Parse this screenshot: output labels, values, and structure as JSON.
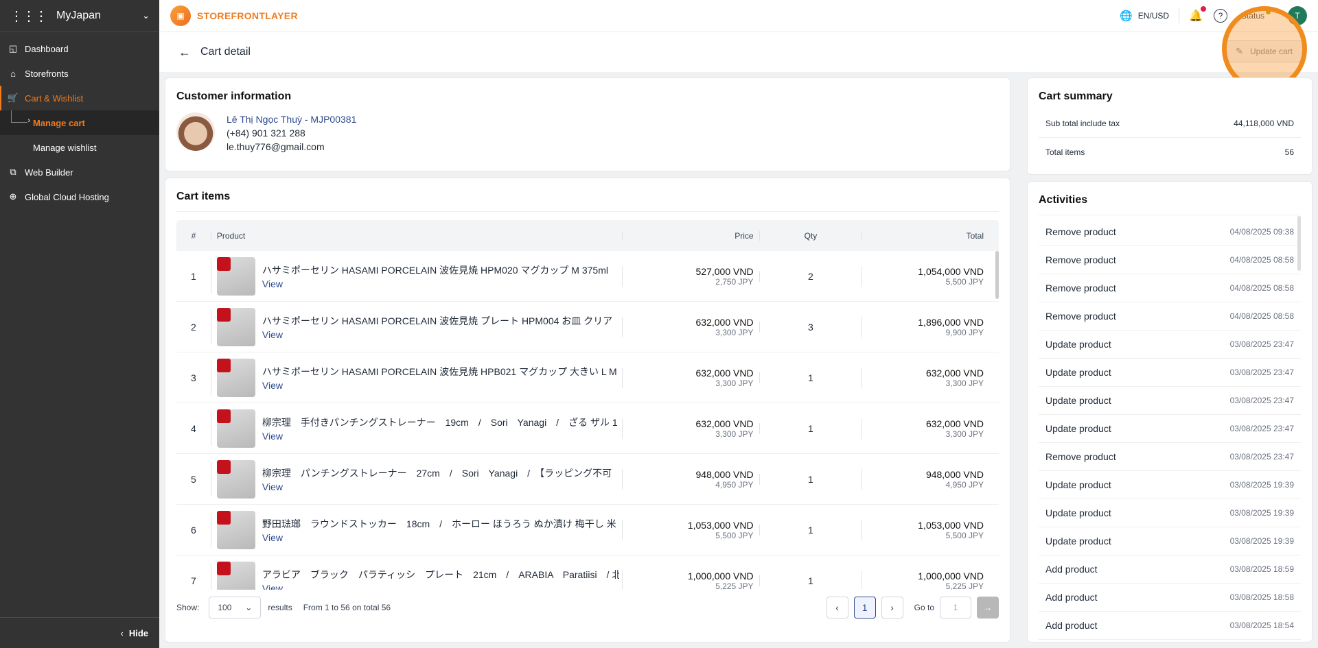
{
  "sidebar": {
    "app_name": "MyJapan",
    "items": [
      {
        "label": "Dashboard",
        "icon": "dashboard-icon"
      },
      {
        "label": "Storefronts",
        "icon": "storefront-icon"
      },
      {
        "label": "Cart & Wishlist",
        "icon": "cart-icon"
      },
      {
        "label": "Web Builder",
        "icon": "web-builder-icon"
      },
      {
        "label": "Global Cloud Hosting",
        "icon": "cloud-hosting-icon"
      }
    ],
    "sub_items": [
      {
        "label": "Manage cart"
      },
      {
        "label": "Manage wishlist"
      }
    ],
    "hide_label": "Hide"
  },
  "topbar": {
    "brand": "STOREFRONTLAYER",
    "locale": "EN/USD",
    "status_label": "Status",
    "avatar_initial": "T"
  },
  "page": {
    "title": "Cart detail",
    "update_button": "Update cart"
  },
  "customer": {
    "heading": "Customer information",
    "name": "Lê Thị Ngọc Thuỳ - MJP00381",
    "phone": "(+84) 901 321 288",
    "email": "le.thuy776@gmail.com"
  },
  "cart_items": {
    "heading": "Cart items",
    "columns": {
      "num": "#",
      "product": "Product",
      "price": "Price",
      "qty": "Qty",
      "total": "Total"
    },
    "view_label": "View",
    "rows": [
      {
        "num": "1",
        "name": "ハサミポーセリン HASAMI PORCELAIN 波佐見焼 HPM020 マグカップ M 375ml",
        "price": "527,000 VND",
        "price_jpy": "2,750 JPY",
        "qty": "2",
        "total": "1,054,000 VND",
        "total_jpy": "5,500 JPY"
      },
      {
        "num": "2",
        "name": "ハサミポーセリン HASAMI PORCELAIN 波佐見焼 プレート HPM004 お皿 クリア",
        "price": "632,000 VND",
        "price_jpy": "3,300 JPY",
        "qty": "3",
        "total": "1,896,000 VND",
        "total_jpy": "9,900 JPY"
      },
      {
        "num": "3",
        "name": "ハサミポーセリン HASAMI PORCELAIN 波佐見焼 HPB021 マグカップ 大きい L M",
        "price": "632,000 VND",
        "price_jpy": "3,300 JPY",
        "qty": "1",
        "total": "632,000 VND",
        "total_jpy": "3,300 JPY"
      },
      {
        "num": "4",
        "name": "柳宗理　手付きパンチングストレーナー　19cm　/　Sori　Yanagi　/　ざる ザル 1",
        "price": "632,000 VND",
        "price_jpy": "3,300 JPY",
        "qty": "1",
        "total": "632,000 VND",
        "total_jpy": "3,300 JPY"
      },
      {
        "num": "5",
        "name": "柳宗理　パンチングストレーナー　27cm　/　Sori　Yanagi　/　【ラッピング不可",
        "price": "948,000 VND",
        "price_jpy": "4,950 JPY",
        "qty": "1",
        "total": "948,000 VND",
        "total_jpy": "4,950 JPY"
      },
      {
        "num": "6",
        "name": "野田琺瑯　ラウンドストッカー　18cm　/　ホーロー ほうろう ぬか漬け 梅干し 米",
        "price": "1,053,000 VND",
        "price_jpy": "5,500 JPY",
        "qty": "1",
        "total": "1,053,000 VND",
        "total_jpy": "5,500 JPY"
      },
      {
        "num": "7",
        "name": "アラビア　ブラック　パラティッシ　プレート　21cm　/　ARABIA　Paratiisi　/ 北",
        "price": "1,000,000 VND",
        "price_jpy": "5,225 JPY",
        "qty": "1",
        "total": "1,000,000 VND",
        "total_jpy": "5,225 JPY"
      }
    ],
    "footer": {
      "show_label": "Show:",
      "page_size": "100",
      "results_label": "results",
      "range_text": "From 1 to 56 on total 56",
      "current_page": "1",
      "goto_label": "Go to",
      "goto_placeholder": "1"
    }
  },
  "summary": {
    "heading": "Cart summary",
    "rows": [
      {
        "label": "Sub total include tax",
        "value": "44,118,000 VND"
      },
      {
        "label": "Total items",
        "value": "56"
      }
    ]
  },
  "activities": {
    "heading": "Activities",
    "rows": [
      {
        "action": "Remove product",
        "date": "04/08/2025 09:38"
      },
      {
        "action": "Remove product",
        "date": "04/08/2025 08:58"
      },
      {
        "action": "Remove product",
        "date": "04/08/2025 08:58"
      },
      {
        "action": "Remove product",
        "date": "04/08/2025 08:58"
      },
      {
        "action": "Update product",
        "date": "03/08/2025 23:47"
      },
      {
        "action": "Update product",
        "date": "03/08/2025 23:47"
      },
      {
        "action": "Update product",
        "date": "03/08/2025 23:47"
      },
      {
        "action": "Update product",
        "date": "03/08/2025 23:47"
      },
      {
        "action": "Remove product",
        "date": "03/08/2025 23:47"
      },
      {
        "action": "Update product",
        "date": "03/08/2025 19:39"
      },
      {
        "action": "Update product",
        "date": "03/08/2025 19:39"
      },
      {
        "action": "Update product",
        "date": "03/08/2025 19:39"
      },
      {
        "action": "Add product",
        "date": "03/08/2025 18:59"
      },
      {
        "action": "Add product",
        "date": "03/08/2025 18:58"
      },
      {
        "action": "Add product",
        "date": "03/08/2025 18:54"
      }
    ]
  }
}
